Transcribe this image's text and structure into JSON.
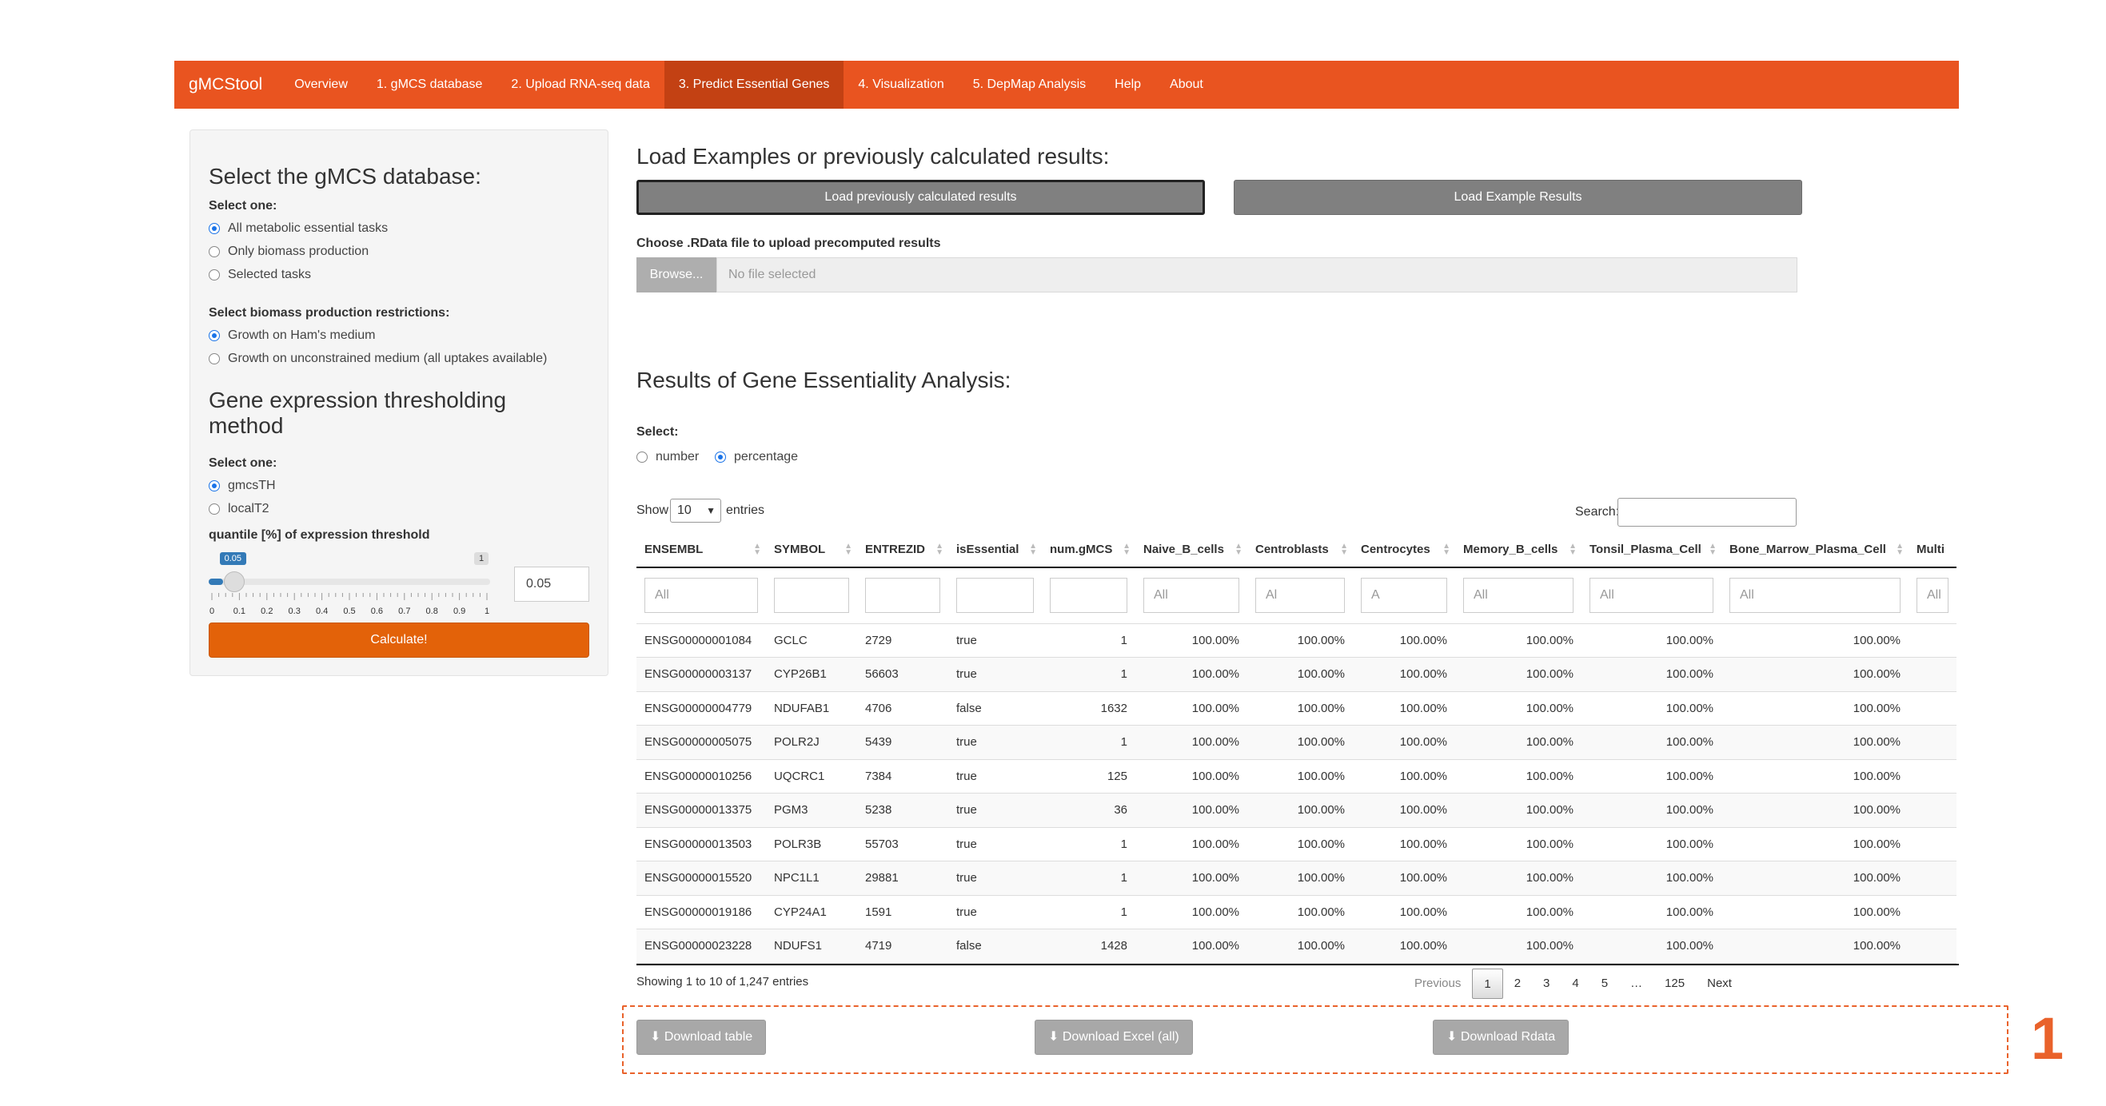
{
  "navbar": {
    "brand": "gMCStool",
    "items": [
      "Overview",
      "1. gMCS database",
      "2. Upload RNA-seq data",
      "3. Predict Essential Genes",
      "4. Visualization",
      "5. DepMap Analysis",
      "Help",
      "About"
    ],
    "active_index": 3
  },
  "sidebar": {
    "db_title": "Select the gMCS database:",
    "select_one": "Select one:",
    "db_options": [
      "All metabolic essential tasks",
      "Only biomass production",
      "Selected tasks"
    ],
    "db_selected": 0,
    "biomass_label": "Select biomass production restrictions:",
    "biomass_options": [
      "Growth on Ham's medium",
      "Growth on unconstrained medium (all uptakes available)"
    ],
    "biomass_selected": 0,
    "threshold_title": "Gene expression thresholding method",
    "threshold_select_one": "Select one:",
    "threshold_options": [
      "gmcsTH",
      "localT2"
    ],
    "threshold_selected": 0,
    "quantile_label": "quantile [%] of expression threshold",
    "slider_value": "0.05",
    "slider_max": "1",
    "slider_fraction": 0.05,
    "slider_ticks": [
      "0",
      "0.1",
      "0.2",
      "0.3",
      "0.4",
      "0.5",
      "0.6",
      "0.7",
      "0.8",
      "0.9",
      "1"
    ],
    "quantile_input": "0.05",
    "calculate": "Calculate!"
  },
  "load": {
    "title": "Load Examples or previously calculated results:",
    "btn_previous": "Load previously calculated results",
    "btn_example": "Load Example Results",
    "file_label": "Choose .RData file to upload precomputed results",
    "browse": "Browse...",
    "no_file": "No file selected"
  },
  "results": {
    "title": "Results of Gene Essentiality Analysis:",
    "select_label": "Select:",
    "modes": [
      "number",
      "percentage"
    ],
    "mode_selected": 1,
    "show_label": "Show",
    "show_value": "10",
    "entries_label": "entries",
    "search_label": "Search:",
    "columns": [
      "ENSEMBL",
      "SYMBOL",
      "ENTREZID",
      "isEssential",
      "num.gMCS",
      "Naive_B_cells",
      "Centroblasts",
      "Centrocytes",
      "Memory_B_cells",
      "Tonsil_Plasma_Cell",
      "Bone_Marrow_Plasma_Cell",
      "Multi"
    ],
    "filters": [
      "All",
      "",
      "",
      "",
      "",
      "All",
      "Al",
      "A",
      "All",
      "All",
      "All",
      "All"
    ],
    "rows": [
      [
        "ENSG00000001084",
        "GCLC",
        "2729",
        "true",
        "1",
        "100.00%",
        "100.00%",
        "100.00%",
        "100.00%",
        "100.00%",
        "100.00%"
      ],
      [
        "ENSG00000003137",
        "CYP26B1",
        "56603",
        "true",
        "1",
        "100.00%",
        "100.00%",
        "100.00%",
        "100.00%",
        "100.00%",
        "100.00%"
      ],
      [
        "ENSG00000004779",
        "NDUFAB1",
        "4706",
        "false",
        "1632",
        "100.00%",
        "100.00%",
        "100.00%",
        "100.00%",
        "100.00%",
        "100.00%"
      ],
      [
        "ENSG00000005075",
        "POLR2J",
        "5439",
        "true",
        "1",
        "100.00%",
        "100.00%",
        "100.00%",
        "100.00%",
        "100.00%",
        "100.00%"
      ],
      [
        "ENSG00000010256",
        "UQCRC1",
        "7384",
        "true",
        "125",
        "100.00%",
        "100.00%",
        "100.00%",
        "100.00%",
        "100.00%",
        "100.00%"
      ],
      [
        "ENSG00000013375",
        "PGM3",
        "5238",
        "true",
        "36",
        "100.00%",
        "100.00%",
        "100.00%",
        "100.00%",
        "100.00%",
        "100.00%"
      ],
      [
        "ENSG00000013503",
        "POLR3B",
        "55703",
        "true",
        "1",
        "100.00%",
        "100.00%",
        "100.00%",
        "100.00%",
        "100.00%",
        "100.00%"
      ],
      [
        "ENSG00000015520",
        "NPC1L1",
        "29881",
        "true",
        "1",
        "100.00%",
        "100.00%",
        "100.00%",
        "100.00%",
        "100.00%",
        "100.00%"
      ],
      [
        "ENSG00000019186",
        "CYP24A1",
        "1591",
        "true",
        "1",
        "100.00%",
        "100.00%",
        "100.00%",
        "100.00%",
        "100.00%",
        "100.00%"
      ],
      [
        "ENSG00000023228",
        "NDUFS1",
        "4719",
        "false",
        "1428",
        "100.00%",
        "100.00%",
        "100.00%",
        "100.00%",
        "100.00%",
        "100.00%"
      ]
    ],
    "info": "Showing 1 to 10 of 1,247 entries",
    "pager": [
      "Previous",
      "1",
      "2",
      "3",
      "4",
      "5",
      "…",
      "125",
      "Next"
    ],
    "pager_current": 1
  },
  "downloads": {
    "table": "Download table",
    "excel": "Download Excel (all)",
    "rdata": "Download Rdata",
    "marker": "1"
  },
  "colors": {
    "navbar": "#e95420",
    "navbar_active": "#c34113",
    "calculate": "#e36209",
    "annotation": "#e9622b"
  },
  "icons": {
    "download": "download-icon",
    "sort": "sort-icon"
  }
}
